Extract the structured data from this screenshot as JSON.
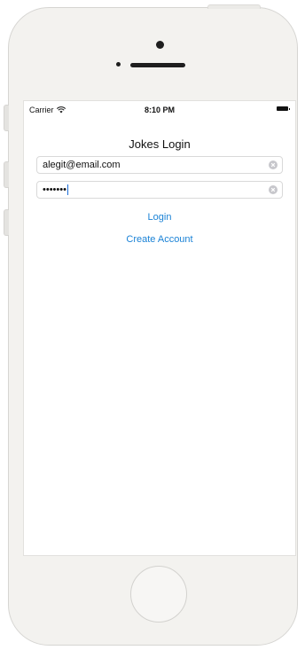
{
  "status_bar": {
    "carrier": "Carrier",
    "time": "8:10 PM"
  },
  "screen": {
    "title": "Jokes Login",
    "email_field": {
      "value": "alegit@email.com"
    },
    "password_field": {
      "value": "•••••••"
    },
    "login_label": "Login",
    "create_account_label": "Create Account"
  },
  "colors": {
    "link": "#1a82d6",
    "phone_body": "#f3f2ef",
    "cursor": "#1a6cd8"
  },
  "icons": [
    "wifi-icon",
    "battery-icon",
    "clear-icon"
  ]
}
